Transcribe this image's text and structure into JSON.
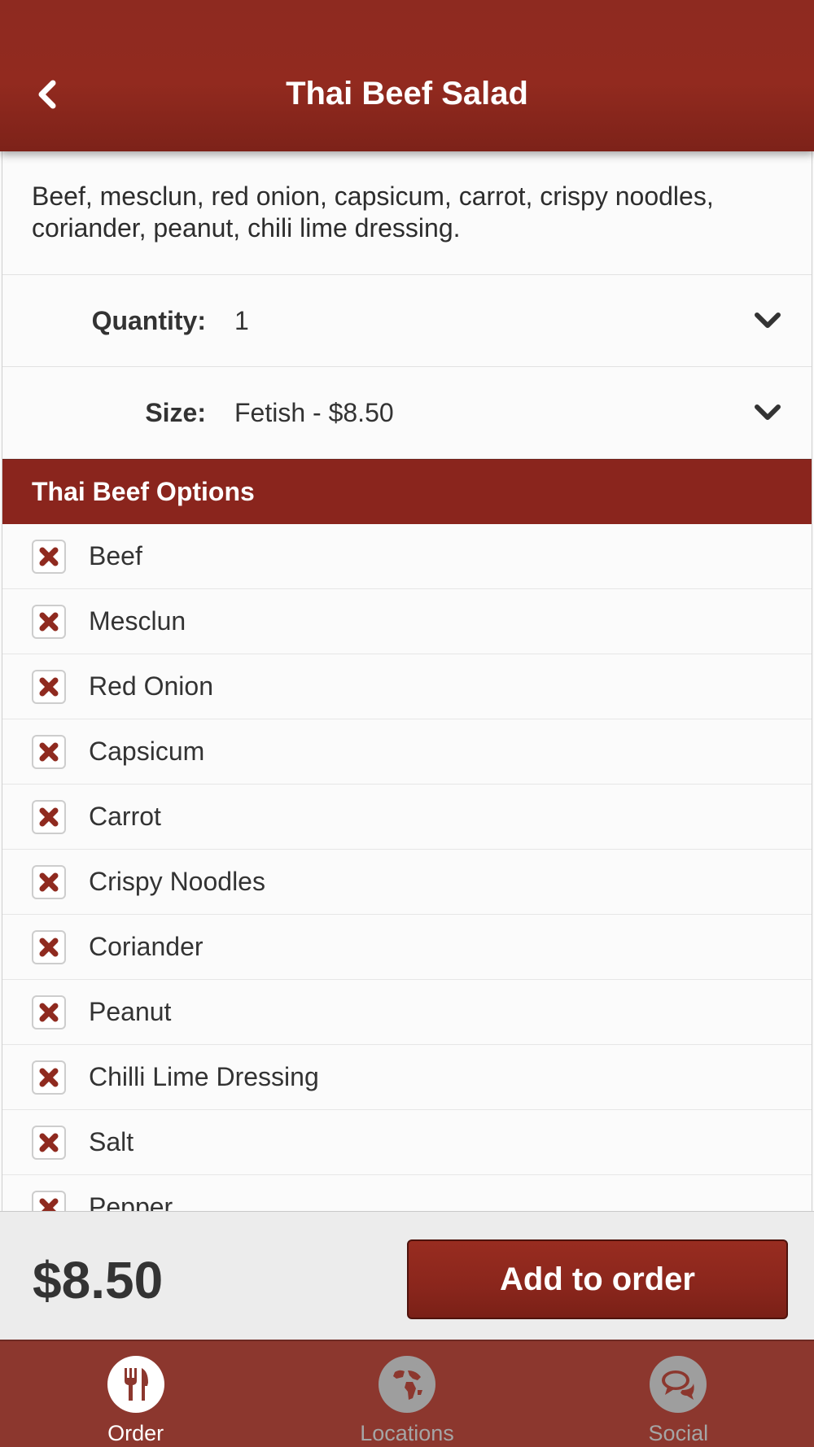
{
  "header": {
    "title": "Thai Beef Salad",
    "back_icon": "chevron-left-icon"
  },
  "description": "Beef, mesclun, red onion, capsicum, carrot, crispy noodles, coriander, peanut, chili lime dressing.",
  "quantity": {
    "label": "Quantity:",
    "value": "1"
  },
  "size": {
    "label": "Size:",
    "value": "Fetish - $8.50"
  },
  "options_section": {
    "title": "Thai Beef Options",
    "items": [
      {
        "label": "Beef",
        "state": "excluded"
      },
      {
        "label": "Mesclun",
        "state": "excluded"
      },
      {
        "label": "Red Onion",
        "state": "excluded"
      },
      {
        "label": "Capsicum",
        "state": "excluded"
      },
      {
        "label": "Carrot",
        "state": "excluded"
      },
      {
        "label": "Crispy Noodles",
        "state": "excluded"
      },
      {
        "label": "Coriander",
        "state": "excluded"
      },
      {
        "label": "Peanut",
        "state": "excluded"
      },
      {
        "label": "Chilli Lime Dressing",
        "state": "excluded"
      },
      {
        "label": "Salt",
        "state": "excluded"
      },
      {
        "label": "Pepper",
        "state": "excluded"
      }
    ]
  },
  "footer": {
    "price": "$8.50",
    "add_button_label": "Add to order"
  },
  "tabs": [
    {
      "label": "Order",
      "icon": "fork-knife-icon",
      "active": true
    },
    {
      "label": "Locations",
      "icon": "globe-icon",
      "active": false
    },
    {
      "label": "Social",
      "icon": "chat-bubbles-icon",
      "active": false
    }
  ],
  "colors": {
    "brand_red": "#8a251d",
    "tab_bar": "#8c372e",
    "check_mark": "#8f2a1f"
  }
}
